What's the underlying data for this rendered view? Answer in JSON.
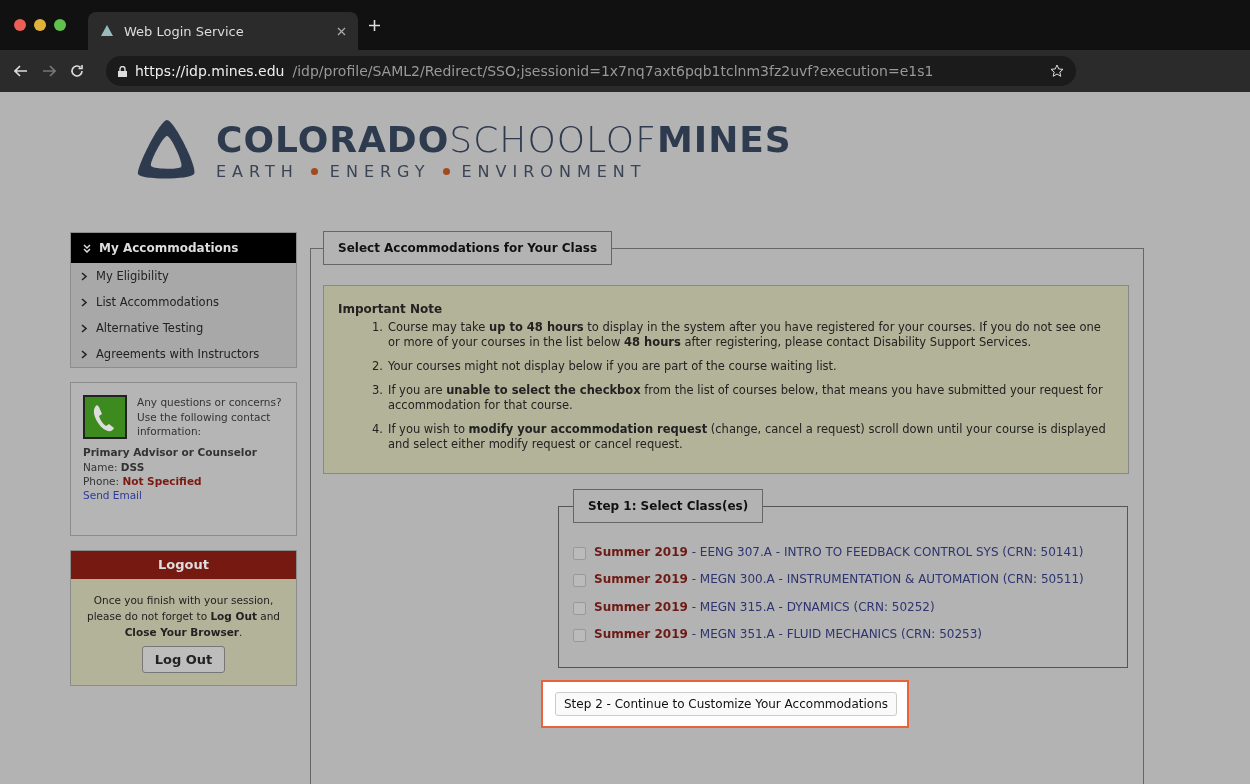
{
  "browser": {
    "tab": {
      "title": "Web Login Service",
      "selected": true
    },
    "url": {
      "host": "https://idp.mines.edu",
      "path": "/idp/profile/SAML2/Redirect/SSO;jsessionid=1x7nq7axt6pqb1tclnm3fz2uvf?execution=e1s1"
    },
    "forward_disabled": true
  },
  "logo": {
    "name": "**COLORADO**SCHOOLOF**MINES**",
    "tagline": [
      "EARTH",
      "ENERGY",
      "ENVIRONMENT"
    ]
  },
  "sidebar": {
    "menu_title": "My Accommodations",
    "items": [
      {
        "label": "My Eligibility"
      },
      {
        "label": "List Accommodations"
      },
      {
        "label": "Alternative Testing"
      },
      {
        "label": "Agreements with Instructors"
      }
    ],
    "contact": {
      "intro": "Any questions or concerns? Use the following contact information:",
      "role": "Primary Advisor or Counselor",
      "name": "Name: **DSS**",
      "phone_label": "Phone:",
      "phone_value": "Not Specified",
      "link": "Send Email"
    },
    "logout": {
      "title": "Logout",
      "message": "Once you finish with your session, please do not forget to **Log Out** and **Close Your Browser**.",
      "button": "Log Out"
    }
  },
  "main": {
    "legend": "Select Accommodations for Your Class",
    "note": {
      "title": "Important Note",
      "items": [
        {
          "number": "1.",
          "text": "Course may take **up to 48 hours** to display in the system after you have registered for your courses. If you do not see one or more of your courses in the list below **48 hours** after registering, please contact Disability Support Services."
        },
        {
          "number": "2.",
          "text": "Your courses might not display below if you are part of the course waiting list."
        },
        {
          "number": "3.",
          "text": "If you are **unable to select the checkbox** from the list of courses below, that means you have submitted your request for accommodation for that course."
        },
        {
          "number": "4.",
          "text": "If you wish to **modify your accommodation request** (change, cancel a request) scroll down until your course is displayed and select either modify request or cancel request."
        }
      ]
    },
    "step1": {
      "legend": "Step 1: Select Class(es)",
      "courses": [
        {
          "term": "Summer 2019",
          "details": "- EENG 307.A - INTRO TO FEEDBACK CONTROL SYS (CRN: 50141)",
          "checked": false
        },
        {
          "term": "Summer 2019",
          "details": "- MEGN 300.A - INSTRUMENTATION & AUTOMATION (CRN: 50511)",
          "checked": false
        },
        {
          "term": "Summer 2019",
          "details": "- MEGN 315.A - DYNAMICS (CRN: 50252)",
          "checked": false
        },
        {
          "term": "Summer 2019",
          "details": "- MEGN 351.A - FLUID MECHANICS (CRN: 50253)",
          "checked": false
        }
      ]
    },
    "step2_button": {
      "label": "Step 2 - Continue to Customize Your Accommodations",
      "highlighted": true
    }
  }
}
